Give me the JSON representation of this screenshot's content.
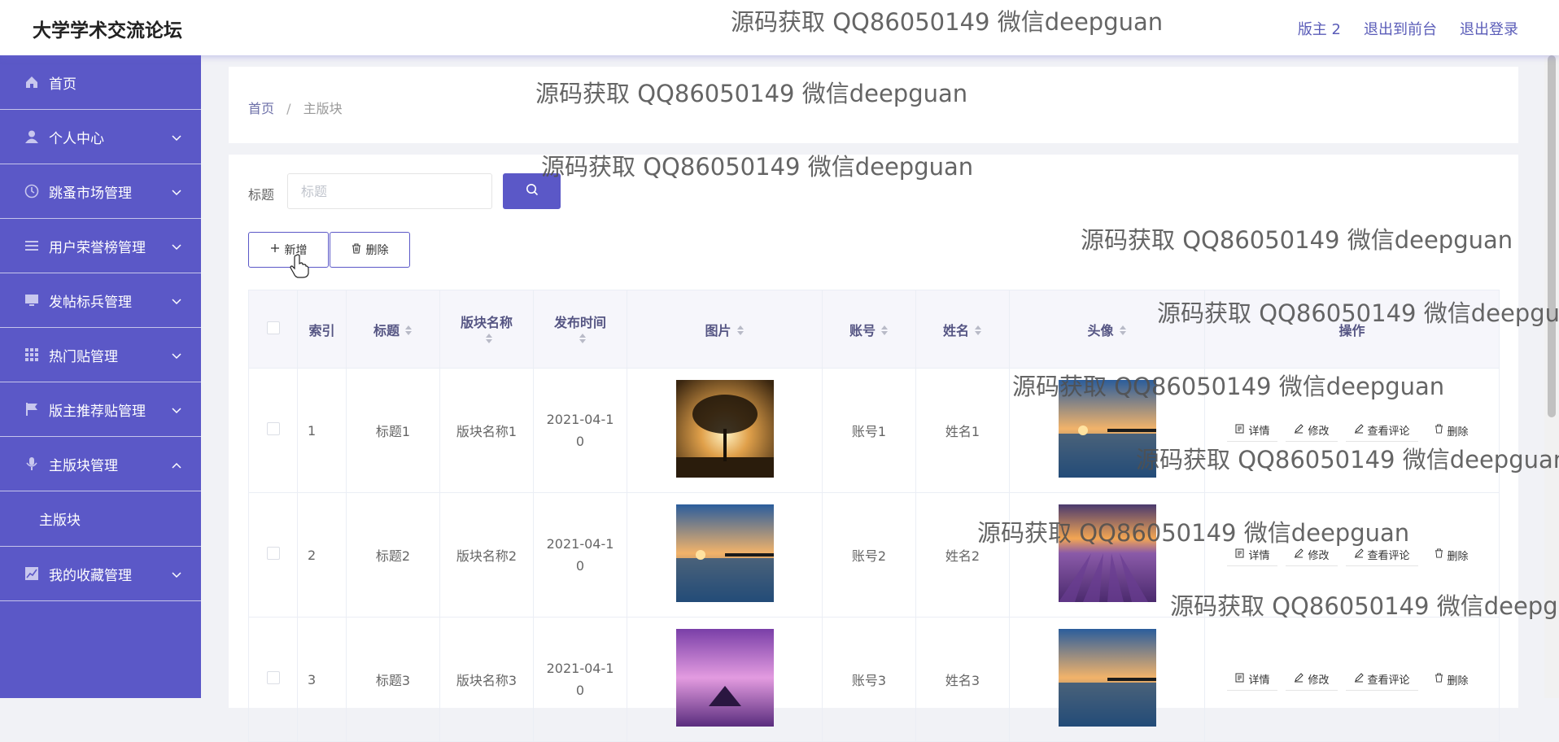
{
  "header": {
    "title": "大学学术交流论坛",
    "links": [
      "版主 2",
      "退出到前台",
      "退出登录"
    ]
  },
  "sidebar": {
    "items": [
      {
        "label": "首页",
        "icon": "home-icon"
      },
      {
        "label": "个人中心",
        "icon": "user-icon"
      },
      {
        "label": "跳蚤市场管理",
        "icon": "clock-icon"
      },
      {
        "label": "用户荣誉榜管理",
        "icon": "list-icon"
      },
      {
        "label": "发帖标兵管理",
        "icon": "monitor-icon"
      },
      {
        "label": "热门贴管理",
        "icon": "grid-icon"
      },
      {
        "label": "版主推荐贴管理",
        "icon": "flag-icon"
      },
      {
        "label": "主版块管理",
        "icon": "mic-icon"
      },
      {
        "label": "我的收藏管理",
        "icon": "chart-icon"
      }
    ],
    "sub_item": "主版块"
  },
  "breadcrumb": {
    "home": "首页",
    "sep": "/",
    "current": "主版块"
  },
  "search": {
    "label": "标题",
    "placeholder": "标题"
  },
  "buttons": {
    "add": "新增",
    "delete": "删除"
  },
  "table": {
    "headers": [
      "索引",
      "标题",
      "版块名称",
      "发布时间",
      "图片",
      "账号",
      "姓名",
      "头像",
      "操作"
    ],
    "rows": [
      {
        "index": "1",
        "title": "标题1",
        "section": "版块名称1",
        "time": "2021-04-10",
        "account": "账号1",
        "name": "姓名1",
        "image": "tree-sunset",
        "avatar": "pier-sunset"
      },
      {
        "index": "2",
        "title": "标题2",
        "section": "版块名称2",
        "time": "2021-04-10",
        "account": "账号2",
        "name": "姓名2",
        "image": "pier-sunset",
        "avatar": "lavender-field"
      },
      {
        "index": "3",
        "title": "标题3",
        "section": "版块名称3",
        "time": "2021-04-10",
        "account": "账号3",
        "name": "姓名3",
        "image": "purple-island",
        "avatar": "pier-sunset"
      }
    ],
    "ops": {
      "detail": "详情",
      "edit": "修改",
      "comments": "查看评论",
      "delete": "删除"
    }
  },
  "watermark": "源码获取 QQ86050149 微信deepguan",
  "colors": {
    "accent": "#5b58c7",
    "header_text": "#555583"
  }
}
